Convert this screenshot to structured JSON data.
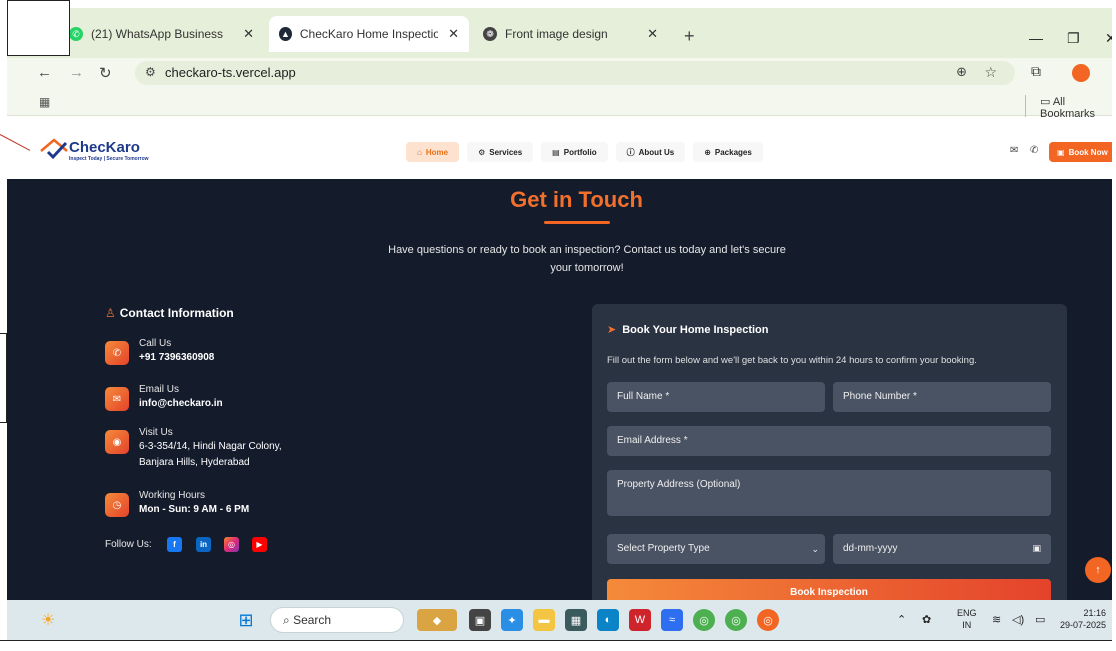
{
  "browser": {
    "tabs": [
      {
        "title": "(21) WhatsApp Business",
        "favicon_color": "#25d366"
      },
      {
        "title": "ChecKaro Home Inspection - In",
        "favicon_color": "#1f2937",
        "active": true
      },
      {
        "title": "Front image design",
        "favicon_color": "#444444"
      }
    ],
    "new_tab": "+",
    "url": "checkaro-ts.vercel.app",
    "all_bookmarks": "All Bookmarks"
  },
  "site": {
    "brand": {
      "name": "ChecKaro",
      "tagline": "Inspect Today | Secure Tomorrow"
    },
    "nav": [
      {
        "label": "Home",
        "icon": "home-icon",
        "active": true
      },
      {
        "label": "Services",
        "icon": "gear-icon"
      },
      {
        "label": "Portfolio",
        "icon": "document-icon"
      },
      {
        "label": "About Us",
        "icon": "info-icon"
      },
      {
        "label": "Packages",
        "icon": "package-icon"
      }
    ],
    "book_now": "Book Now",
    "section": {
      "title": "Get in Touch",
      "subtitle": "Have questions or ready to book an inspection? Contact us today and let's secure your tomorrow!"
    },
    "contact": {
      "heading": "Contact Information",
      "items": [
        {
          "label": "Call Us",
          "value": "+91 7396360908",
          "icon": "phone-icon"
        },
        {
          "label": "Email Us",
          "value": "info@checkaro.in",
          "icon": "mail-icon"
        },
        {
          "label": "Visit Us",
          "value": "6-3-354/14, Hindi Nagar Colony,",
          "value2": "Banjara Hills, Hyderabad",
          "icon": "location-icon"
        },
        {
          "label": "Working Hours",
          "value": "Mon - Sun: 9 AM - 6 PM",
          "icon": "clock-icon"
        }
      ],
      "follow_label": "Follow Us:"
    },
    "form": {
      "title": "Book Your Home Inspection",
      "description": "Fill out the form below and we'll get back to you within 24 hours to confirm your booking.",
      "full_name": "Full Name *",
      "phone": "Phone Number *",
      "email": "Email Address *",
      "property_address": "Property Address (Optional)",
      "property_type": "Select Property Type",
      "date": "dd-mm-yyyy",
      "submit": "Book Inspection"
    }
  },
  "taskbar": {
    "search": "Search",
    "lang_top": "ENG",
    "lang_bottom": "IN",
    "time": "21:16",
    "date": "29-07-2025"
  },
  "colors": {
    "accent": "#f26522",
    "dark_bg": "#141c2c",
    "card_bg": "#2a3342",
    "brand_blue": "#1f3a8a"
  }
}
